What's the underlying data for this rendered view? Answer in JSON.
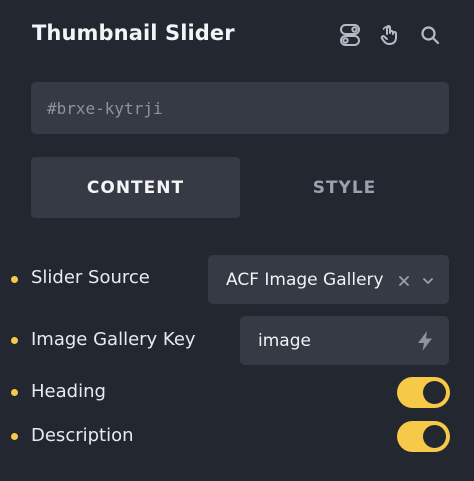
{
  "header": {
    "title": "Thumbnail Slider",
    "icons": [
      "toggle-switch-icon",
      "hand-pointer-icon",
      "search-icon"
    ]
  },
  "css_id": {
    "value": "#brxe-kytrji"
  },
  "tabs": [
    {
      "label": "CONTENT",
      "active": true
    },
    {
      "label": "STYLE",
      "active": false
    }
  ],
  "controls": {
    "slider_source": {
      "label": "Slider Source",
      "value": "ACF Image Gallery"
    },
    "image_gallery_key": {
      "label": "Image Gallery Key",
      "value": "image"
    },
    "heading": {
      "label": "Heading",
      "enabled": true
    },
    "description": {
      "label": "Description",
      "enabled": true
    }
  },
  "colors": {
    "background": "#23272f",
    "field": "#353a44",
    "accent": "#f7c948"
  }
}
